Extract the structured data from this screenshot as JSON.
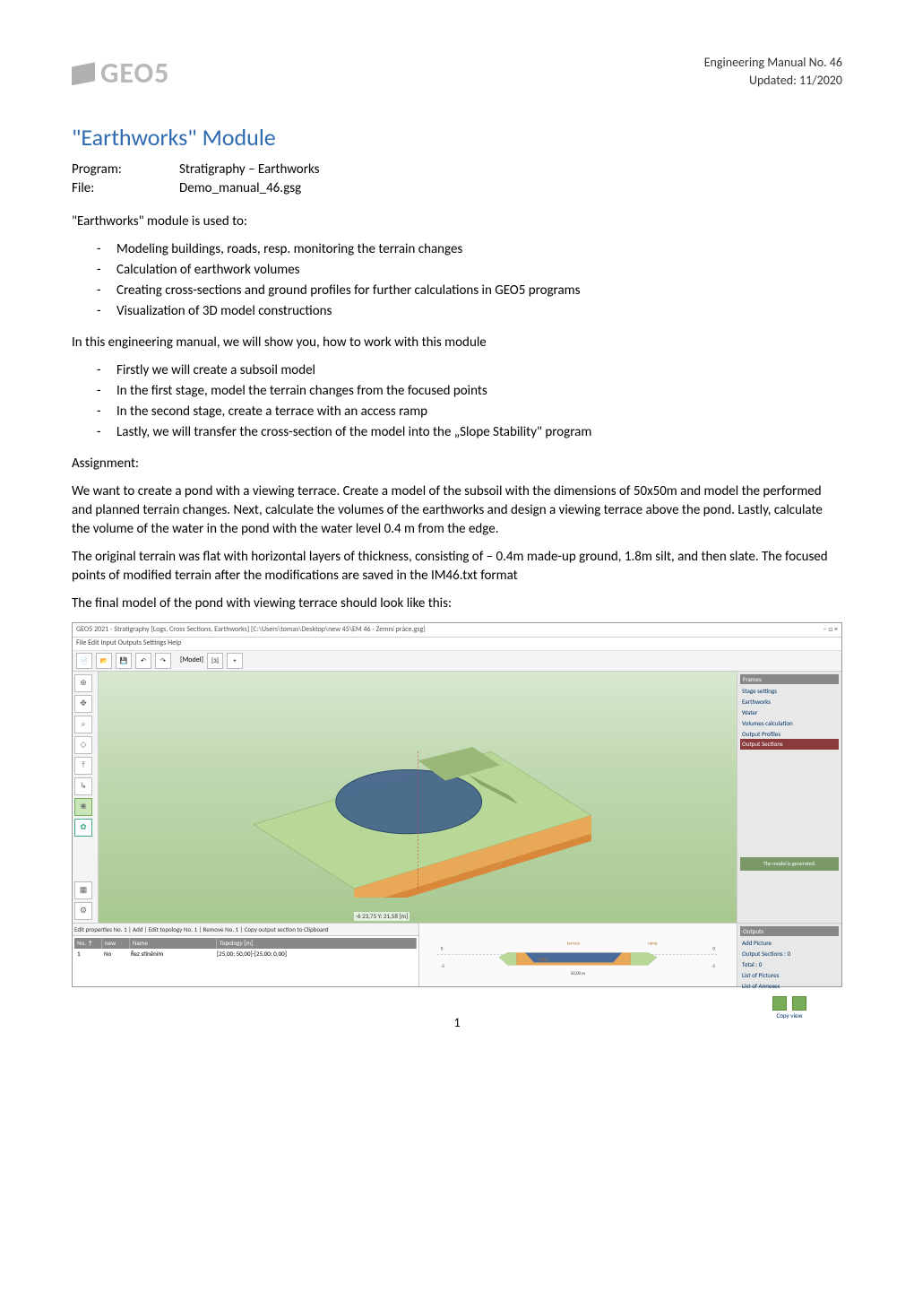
{
  "header": {
    "manual_no": "Engineering Manual No. 46",
    "updated": "Updated: 11/2020",
    "logo_text": "GEO5"
  },
  "title": "\"Earthworks\" Module",
  "meta": {
    "program_label": "Program:",
    "program_value": "Stratigraphy – Earthworks",
    "file_label": "File:",
    "file_value": "Demo_manual_46.gsg"
  },
  "intro": "\"Earthworks\" module is used to:",
  "intro_items": [
    "Modeling buildings, roads, resp. monitoring the terrain changes",
    "Calculation of earthwork volumes",
    "Creating cross-sections and ground profiles for further calculations in GEO5 programs",
    "Visualization of 3D model constructions"
  ],
  "goals_intro": "In this engineering manual, we will show you, how to work with this module",
  "goals_items": [
    "Firstly we will create a subsoil model",
    "In the first stage, model the terrain changes from the focused points",
    "In the second stage, create a terrace with an access ramp",
    "Lastly, we will transfer the cross-section of the model into the „Slope Stability\" program"
  ],
  "assignment_label": "Assignment:",
  "assignment_p1": "We want to create a pond with a viewing terrace. Create a model of the subsoil with the dimensions of 50x50m and model the performed and planned terrain changes. Next, calculate the volumes of the earthworks and design a viewing terrace above the pond. Lastly, calculate the volume of the water in the pond with the water level 0.4 m from the edge.",
  "assignment_p2": "The original terrain was flat with horizontal layers of thickness, consisting of  – 0.4m made-up ground, 1.8m silt, and then slate. The focused points of modified terrain after the modifications are saved in the IM46.txt format",
  "final_model_intro": "The final model of the pond with viewing terrace should look like this:",
  "screenshot": {
    "titlebar": "GEO5 2021 - Stratigraphy [Logs, Cross Sections, Earthworks] [C:\\Users\\tomas\\Desktop\\new 45\\EM 46 - Zemní práce.gsg]",
    "window_controls": "– □ ×",
    "menubar": "File  Edit  Input  Outputs  Settings  Help",
    "toolbar_model_label": "[Model]",
    "toolbar_stage": "[3]",
    "left_tools": [
      "⊕",
      "✥",
      "⌕",
      "◇",
      "⤒",
      "↳",
      "❀",
      "✿",
      "▦",
      "⚙"
    ],
    "coord_readout": "-6 23,75 Y: 21,58 [m]",
    "right_panel": {
      "header": "Frames",
      "items": [
        "Stage settings",
        "Earthworks",
        "Water",
        "Volumes calculation",
        "Output Profiles",
        "Output Sections"
      ],
      "active_index": 5,
      "note": "The model is generated."
    },
    "bottom_left": {
      "toolbar_items": [
        "Edit properties No. 1",
        "Add",
        "Edit topology No. 1",
        "Remove No. 1",
        "Copy output section to Clipboard"
      ],
      "col_no": "No. ↑",
      "col_new": "new",
      "col_name": "Name",
      "col_topology": "Topology [m]",
      "row_no": "1",
      "row_new": "No",
      "row_name": "Řez stíněním",
      "row_topology": "[25,00; 50,00]-[25,00; 0,00]"
    },
    "bottom_right": {
      "labels": [
        "terrace",
        "ramp",
        "water"
      ],
      "xmax": "50,00 m"
    },
    "outputs_panel": {
      "header": "Outputs",
      "items": [
        "Add Picture",
        "Output Sections :",
        "Total :",
        "List of Pictures",
        "List of Annexes"
      ],
      "os_count": "0",
      "total_count": "0",
      "copy_label": "Copy view"
    }
  },
  "page_number": "1"
}
